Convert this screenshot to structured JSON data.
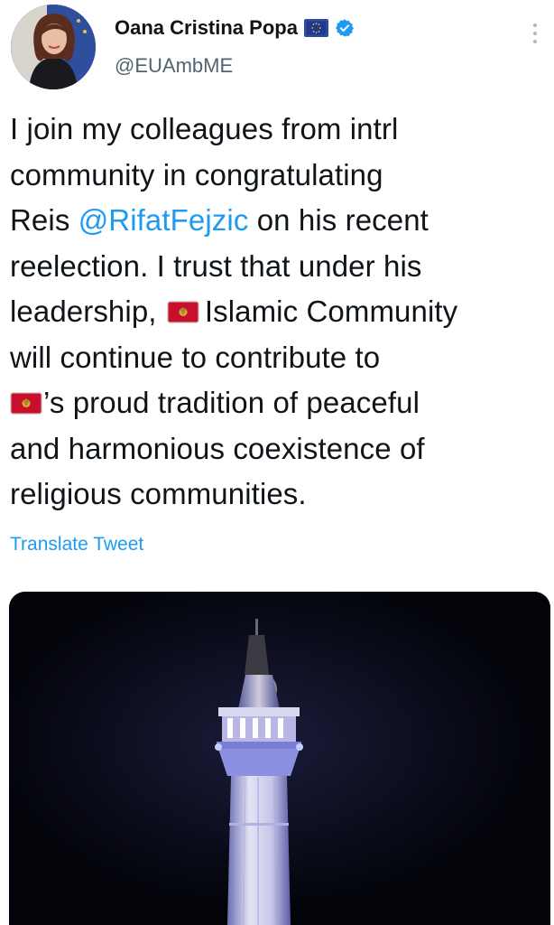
{
  "author": {
    "name": "Oana Cristina Popa",
    "handle": "@EUAmbME",
    "avatar_icon": "profile-photo",
    "badge_icon": "eu-flag-icon",
    "verified_icon": "verified-badge-icon"
  },
  "menu": {
    "icon": "more-vertical-icon"
  },
  "tweet": {
    "line1": "I join my colleagues from intrl",
    "line2": "community in congratulating",
    "line3_pre": "Reis ",
    "mention": "@RifatFejzic",
    "line3_post": " on his recent",
    "line4": "reelection. I trust that under his",
    "line5_pre": "leadership,",
    "line5_post": "Islamic Community",
    "line6": "will continue to contribute to",
    "line7_post": "’s proud tradition of peaceful",
    "line8": "and harmonious coexistence of",
    "line9": "religious communities.",
    "flag_icon": "montenegro-flag-icon"
  },
  "translate_label": "Translate Tweet",
  "media": {
    "subject": "minaret-illuminated-at-night"
  },
  "colors": {
    "link": "#1d9bf0",
    "text": "#0f1419",
    "secondary": "#536471",
    "verified": "#1d9bf0"
  }
}
